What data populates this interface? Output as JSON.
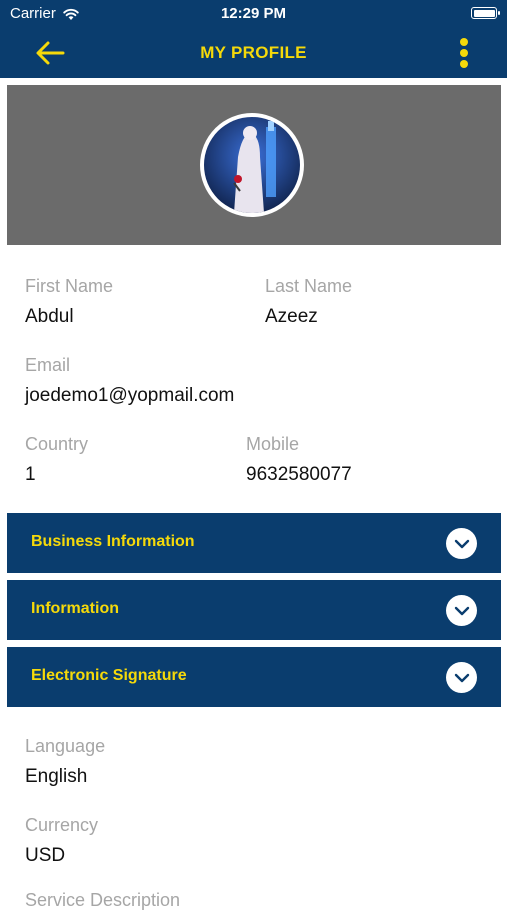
{
  "status_bar": {
    "carrier": "Carrier",
    "time": "12:29 PM"
  },
  "header": {
    "title": "MY PROFILE"
  },
  "profile": {
    "first_name_label": "First Name",
    "first_name": "Abdul",
    "last_name_label": "Last Name",
    "last_name": "Azeez",
    "email_label": "Email",
    "email": "joedemo1@yopmail.com",
    "country_label": "Country",
    "country": "1",
    "mobile_label": "Mobile",
    "mobile": "9632580077"
  },
  "sections": [
    {
      "title": "Business Information"
    },
    {
      "title": "Information"
    },
    {
      "title": "Electronic Signature"
    }
  ],
  "preferences": {
    "language_label": "Language",
    "language": "English",
    "currency_label": "Currency",
    "currency": "USD",
    "service_description_label": "Service Description"
  },
  "colors": {
    "primary": "#0a3d6e",
    "accent": "#f5d90a",
    "cover": "#6b6b6b"
  }
}
